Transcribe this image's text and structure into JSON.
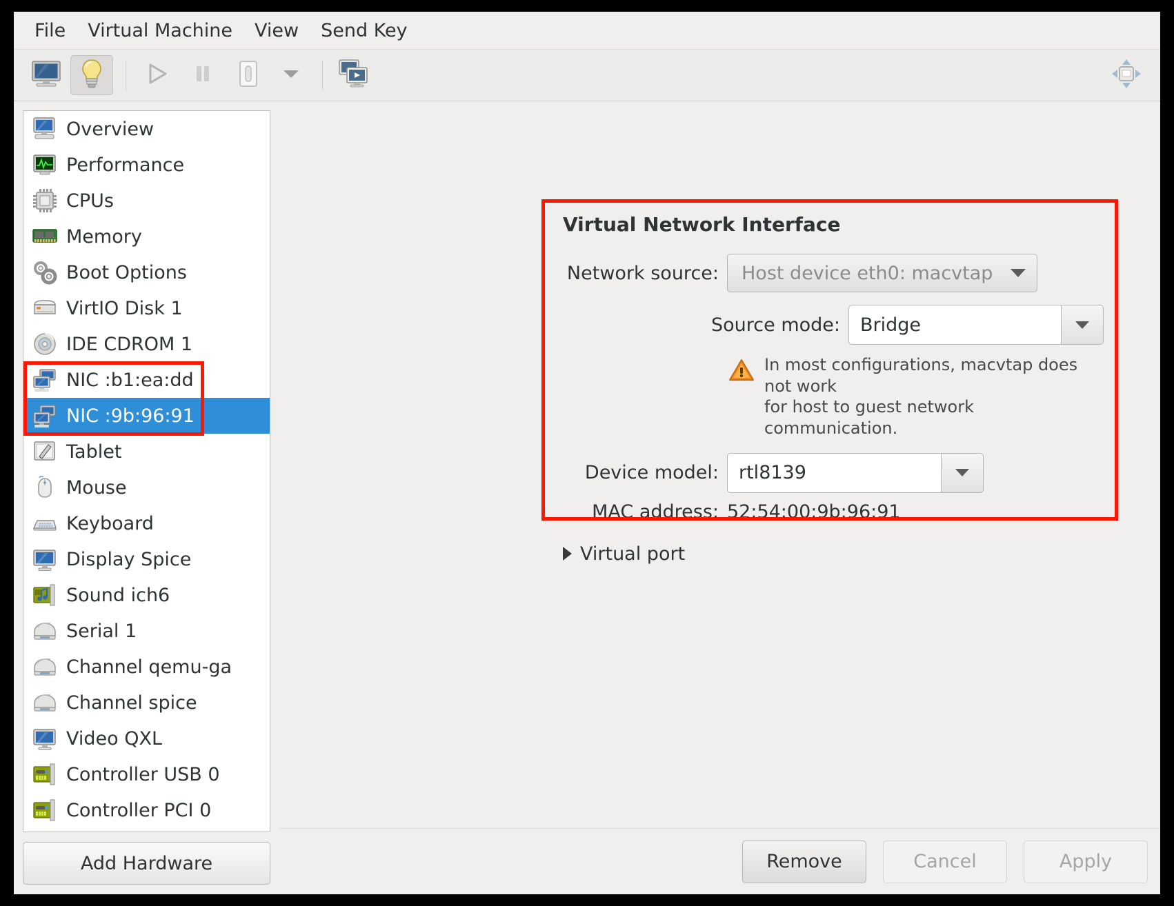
{
  "menubar": {
    "items": [
      {
        "label": "File",
        "name": "menu-file"
      },
      {
        "label": "Virtual Machine",
        "name": "menu-virtual-machine"
      },
      {
        "label": "View",
        "name": "menu-view"
      },
      {
        "label": "Send Key",
        "name": "menu-send-key"
      }
    ]
  },
  "toolbar": {
    "buttons": [
      {
        "icon": "monitor-console-icon",
        "name": "show-console-button",
        "active": false
      },
      {
        "icon": "lightbulb-details-icon",
        "name": "show-details-button",
        "active": true
      },
      {
        "icon": "play-icon",
        "name": "run-button",
        "active": false
      },
      {
        "icon": "pause-icon",
        "name": "pause-button",
        "active": false
      },
      {
        "icon": "power-shutdown-icon",
        "name": "shutdown-button",
        "active": false
      },
      {
        "icon": "chevron-down-icon",
        "name": "shutdown-menu-button",
        "active": false
      },
      {
        "icon": "snapshots-icon",
        "name": "snapshots-button",
        "active": false
      }
    ],
    "expand_icon": "fullscreen-expand-icon"
  },
  "sidebar": {
    "items": [
      {
        "label": "Overview",
        "icon": "computer-icon",
        "selected": false
      },
      {
        "label": "Performance",
        "icon": "graph-monitor-icon",
        "selected": false
      },
      {
        "label": "CPUs",
        "icon": "cpu-chip-icon",
        "selected": false
      },
      {
        "label": "Memory",
        "icon": "memory-ram-icon",
        "selected": false
      },
      {
        "label": "Boot Options",
        "icon": "gears-icon",
        "selected": false
      },
      {
        "label": "VirtIO Disk 1",
        "icon": "harddisk-icon",
        "selected": false
      },
      {
        "label": "IDE CDROM 1",
        "icon": "cdrom-disc-icon",
        "selected": false
      },
      {
        "label": "NIC :b1:ea:dd",
        "icon": "network-card-icon",
        "selected": false
      },
      {
        "label": "NIC :9b:96:91",
        "icon": "network-card-icon",
        "selected": true
      },
      {
        "label": "Tablet",
        "icon": "tablet-pen-icon",
        "selected": false
      },
      {
        "label": "Mouse",
        "icon": "mouse-icon",
        "selected": false
      },
      {
        "label": "Keyboard",
        "icon": "keyboard-icon",
        "selected": false
      },
      {
        "label": "Display Spice",
        "icon": "display-icon",
        "selected": false
      },
      {
        "label": "Sound ich6",
        "icon": "sound-card-icon",
        "selected": false
      },
      {
        "label": "Serial 1",
        "icon": "serial-port-icon",
        "selected": false
      },
      {
        "label": "Channel qemu-ga",
        "icon": "serial-port-icon",
        "selected": false
      },
      {
        "label": "Channel spice",
        "icon": "serial-port-icon",
        "selected": false
      },
      {
        "label": "Video QXL",
        "icon": "display-icon",
        "selected": false
      },
      {
        "label": "Controller USB 0",
        "icon": "pci-card-icon",
        "selected": false
      },
      {
        "label": "Controller PCI 0",
        "icon": "pci-card-icon",
        "selected": false
      }
    ],
    "add_hardware_label": "Add Hardware"
  },
  "panel": {
    "title": "Virtual Network Interface",
    "network_source": {
      "label": "Network source:",
      "value": "Host device eth0: macvtap"
    },
    "source_mode": {
      "label": "Source mode:",
      "value": "Bridge"
    },
    "warning": {
      "icon": "warning-triangle-icon",
      "line1": "In most configurations, macvtap does not work",
      "line2": "for host to guest network communication."
    },
    "device_model": {
      "label": "Device model:",
      "value": "rtl8139"
    },
    "mac_address": {
      "label": "MAC address:",
      "value": "52:54:00:9b:96:91"
    },
    "virtual_port": {
      "label": "Virtual port",
      "expanded": false,
      "icon": "triangle-right-icon"
    }
  },
  "footer": {
    "remove_label": "Remove",
    "cancel_label": "Cancel",
    "apply_label": "Apply"
  },
  "colors": {
    "annotation": "#fc1705",
    "selection": "#2e8fd8",
    "window_bg": "#f0efee"
  }
}
